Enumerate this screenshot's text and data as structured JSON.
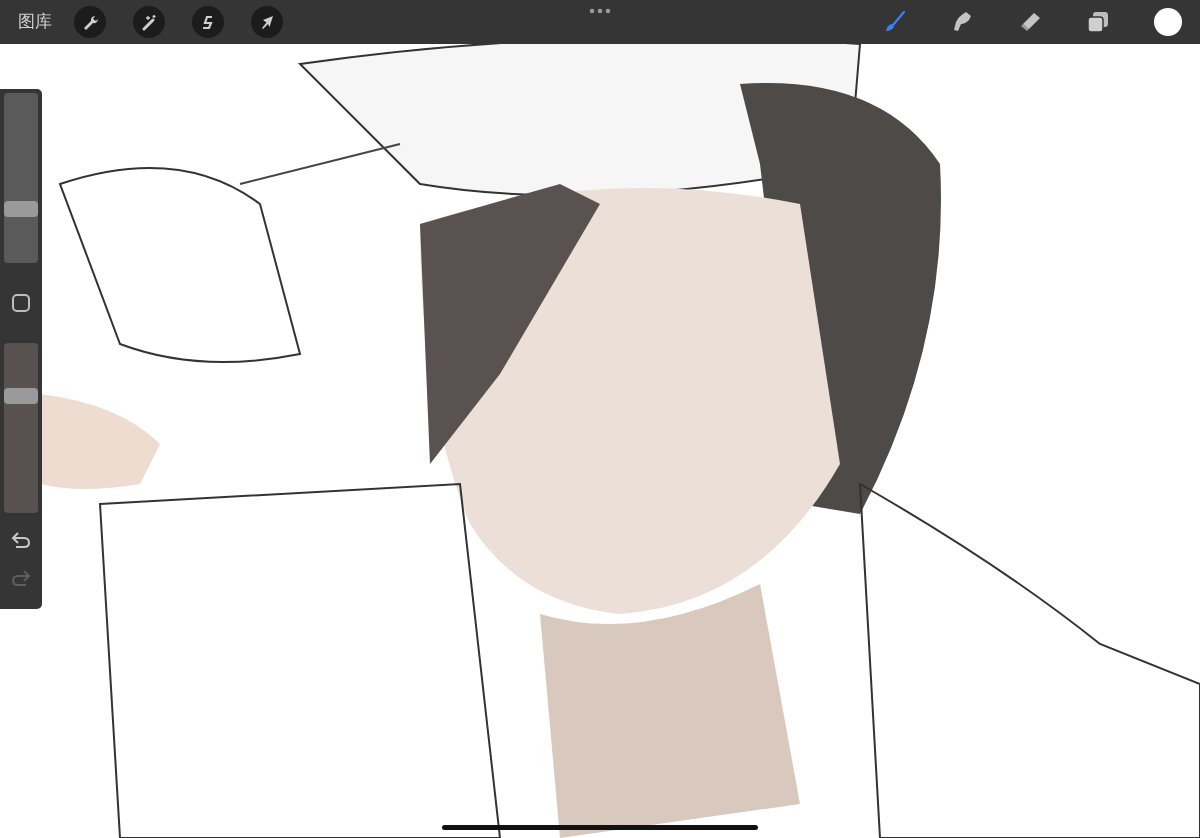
{
  "top_bar": {
    "gallery_label": "图库",
    "actions": [
      {
        "kind": "wrench"
      },
      {
        "kind": "wand"
      },
      {
        "kind": "selection"
      },
      {
        "kind": "transform"
      }
    ],
    "tools": [
      {
        "kind": "brush",
        "selected": true
      },
      {
        "kind": "smudge",
        "selected": false
      },
      {
        "kind": "eraser",
        "selected": false
      }
    ],
    "current_color": {
      "color": "#ffffff"
    }
  },
  "sidebar": {
    "brush_size": {
      "level": 0.3
    },
    "opacity": {
      "level": 0.71
    },
    "redo": {
      "disabled": true
    }
  }
}
